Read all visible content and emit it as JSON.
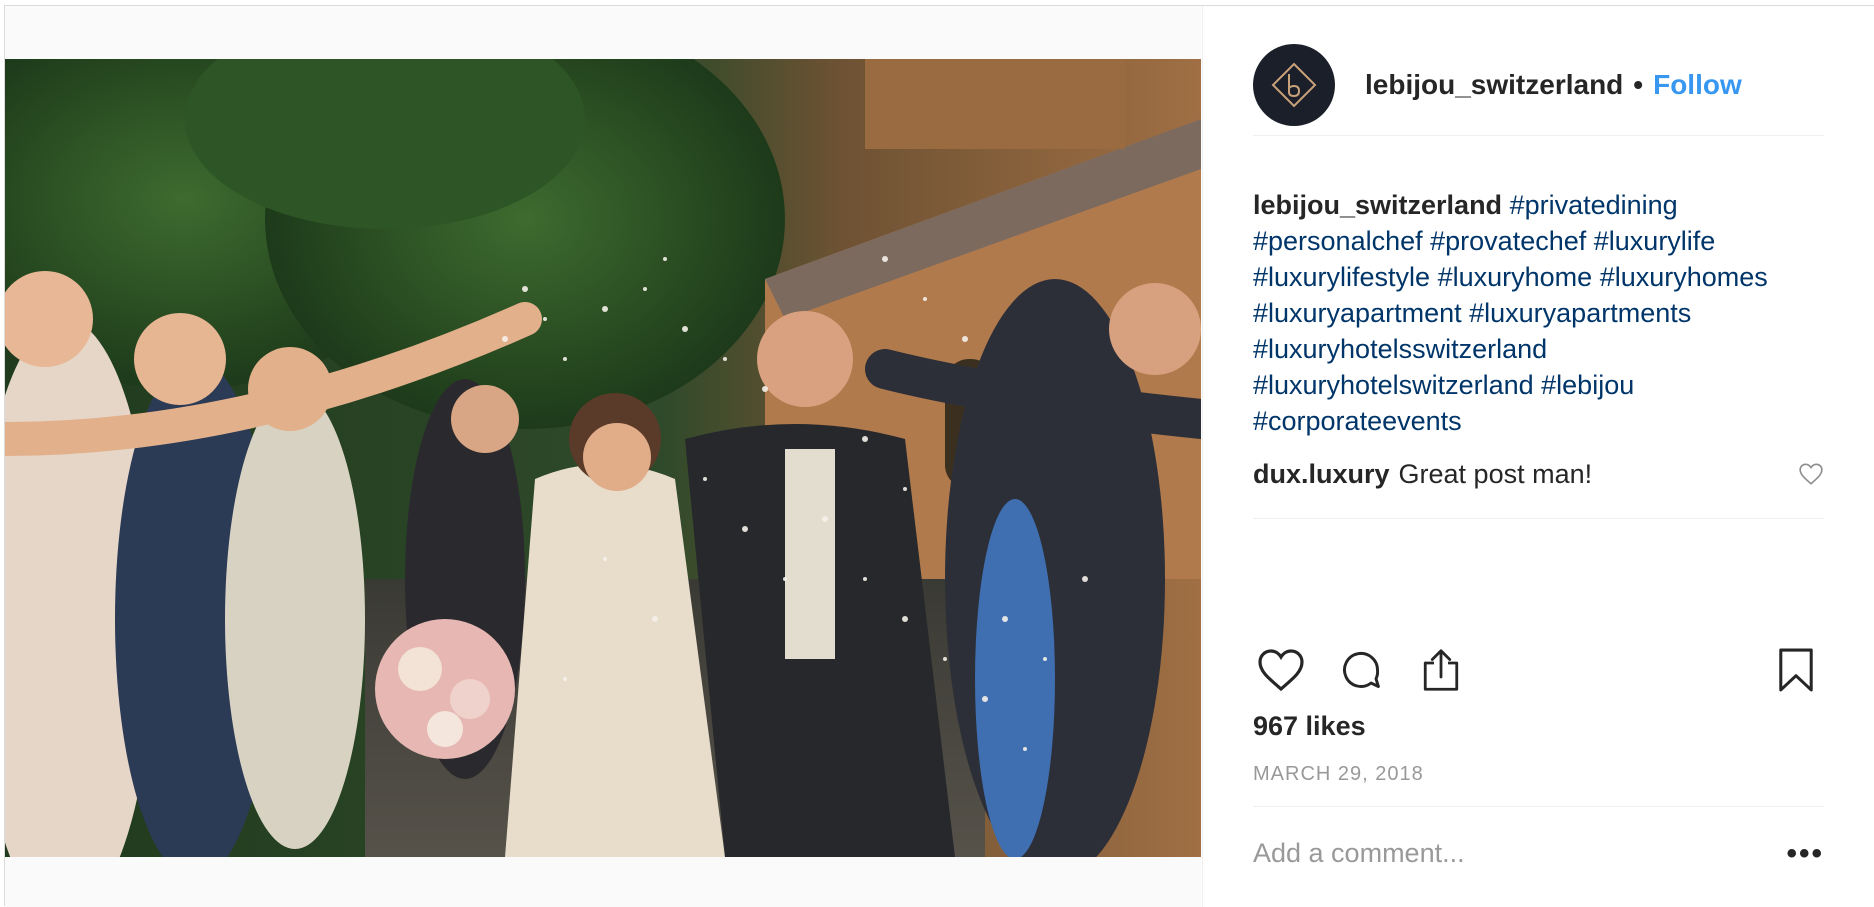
{
  "post": {
    "username": "lebijou_switzerland",
    "follow_label": "Follow",
    "separator": "•",
    "image_icon": "wedding-photo",
    "caption": {
      "username": "lebijou_switzerland",
      "hashtags": [
        "#privatedining",
        "#personalchef",
        "#provatechef",
        "#luxurylife",
        "#luxurylifestyle",
        "#luxuryhome",
        "#luxuryhomes",
        "#luxuryapartment",
        "#luxuryapartments",
        "#luxuryhotelsswitzerland",
        "#luxuryhotelswitzerland",
        "#lebijou",
        "#corporateevents"
      ]
    },
    "comments": [
      {
        "username": "dux.luxury",
        "text": "Great post man!"
      }
    ],
    "likes_text": "967 likes",
    "date_text": "MARCH 29, 2018",
    "add_comment_placeholder": "Add a comment...",
    "more_label": "•••"
  },
  "icons": {
    "like": "heart-icon",
    "comment": "comment-bubble-icon",
    "share": "share-icon",
    "save": "bookmark-icon",
    "comment_like": "small-heart-icon"
  },
  "colors": {
    "follow": "#3897f0",
    "hashtag": "#003569",
    "muted": "#999999",
    "text": "#262626"
  }
}
